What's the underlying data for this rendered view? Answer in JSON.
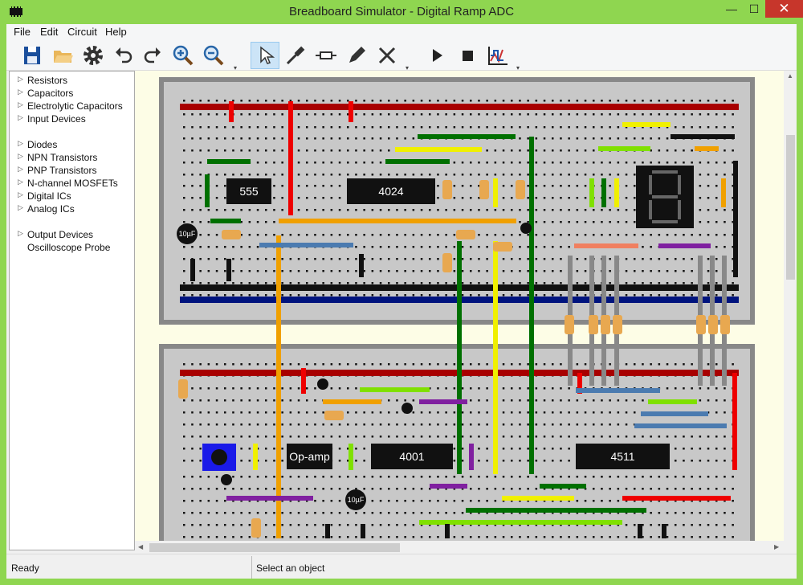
{
  "window": {
    "title": "Breadboard Simulator - Digital Ramp ADC",
    "minimize": "—",
    "maximize": "☐",
    "close": "✕"
  },
  "menu": [
    "File",
    "Edit",
    "Circuit",
    "Help"
  ],
  "toolbar": {
    "icons": [
      "save-icon",
      "open-folder-icon",
      "settings-gear-icon",
      "undo-icon",
      "redo-icon",
      "zoom-in-icon",
      "zoom-out-icon",
      "select-pointer-icon",
      "probe-icon",
      "resistor-icon",
      "pencil-icon",
      "cut-wire-icon",
      "play-icon",
      "stop-icon",
      "scope-icon"
    ]
  },
  "tree": {
    "groups": [
      [
        "Resistors",
        "Capacitors",
        "Electrolytic Capacitors",
        "Input Devices"
      ],
      [
        "Diodes",
        "NPN Transistors",
        "PNP Transistors",
        "N-channel MOSFETs",
        "Digital ICs",
        "Analog ICs"
      ],
      [
        "Output Devices",
        "Oscilloscope Probe"
      ]
    ]
  },
  "chips": {
    "top": [
      "555",
      "4024"
    ],
    "bottom": [
      "Op-amp",
      "4001",
      "4511"
    ]
  },
  "caps": [
    "10µF",
    "10µF"
  ],
  "status": {
    "left": "Ready",
    "right": "Select an object"
  }
}
